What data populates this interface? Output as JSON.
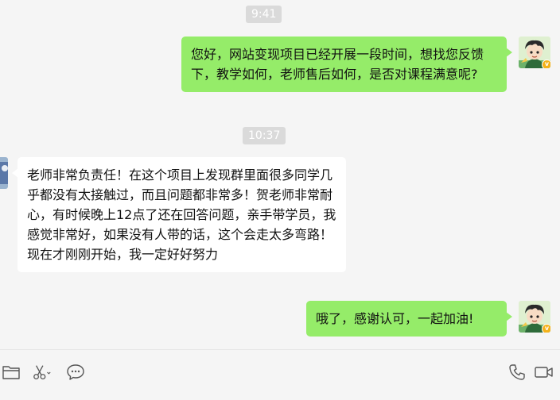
{
  "messages": [
    {
      "type": "timestamp",
      "text": "9:41"
    },
    {
      "type": "outgoing",
      "text": "您好，网站变现项目已经开展一段时间，想找您反馈下，教学如何，老师售后如何，是否对课程满意呢?"
    },
    {
      "type": "timestamp",
      "text": "10:37"
    },
    {
      "type": "incoming",
      "text": "老师非常负责任！在这个项目上发现群里面很多同学几乎都没有太接触过，而且问题都非常多！贺老师非常耐心，有时候晚上12点了还在回答问题，亲手带学员，我感觉非常好，如果没有人带的话，这个会走太多弯路！现在才刚刚开始，我一定好好努力"
    },
    {
      "type": "outgoing",
      "text": "哦了，感谢认可，一起加油!"
    }
  ],
  "icons": {
    "self_avatar": "cartoon-boy-avatar",
    "verified_badge": "v",
    "toolbar": [
      "folder-icon",
      "scissors-icon",
      "chat-bubble-icon",
      "phone-icon",
      "video-call-icon"
    ]
  },
  "colors": {
    "outgoing_bubble": "#95ec69",
    "incoming_bubble": "#ffffff",
    "background": "#f5f5f5",
    "timestamp_bg": "#dadada"
  }
}
